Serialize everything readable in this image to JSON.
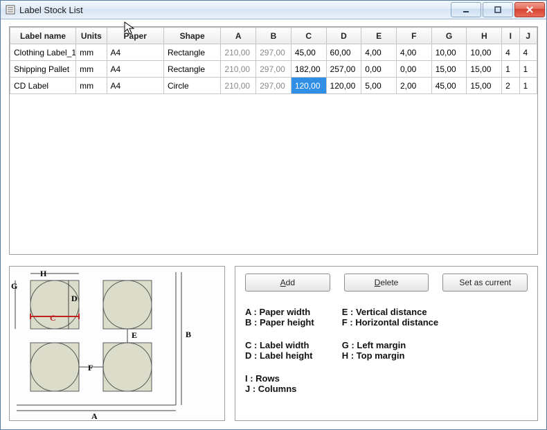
{
  "window": {
    "title": "Label Stock List"
  },
  "grid": {
    "headers": [
      "Label name",
      "Units",
      "Paper",
      "Shape",
      "A",
      "B",
      "C",
      "D",
      "E",
      "F",
      "G",
      "H",
      "I",
      "J"
    ],
    "rows": [
      {
        "name": "Clothing Label_1",
        "units": "mm",
        "paper": "A4",
        "shape": "Rectangle",
        "A": "210,00",
        "B": "297,00",
        "C": "45,00",
        "D": "60,00",
        "E": "4,00",
        "F": "4,00",
        "G": "10,00",
        "H": "10,00",
        "I": "4",
        "J": "4"
      },
      {
        "name": "Shipping Pallet",
        "units": "mm",
        "paper": "A4",
        "shape": "Rectangle",
        "A": "210,00",
        "B": "297,00",
        "C": "182,00",
        "D": "257,00",
        "E": "0,00",
        "F": "0,00",
        "G": "15,00",
        "H": "15,00",
        "I": "1",
        "J": "1"
      },
      {
        "name": "CD Label",
        "units": "mm",
        "paper": "A4",
        "shape": "Circle",
        "A": "210,00",
        "B": "297,00",
        "C": "120,00",
        "D": "120,00",
        "E": "5,00",
        "F": "2,00",
        "G": "45,00",
        "H": "15,00",
        "I": "2",
        "J": "1"
      }
    ],
    "selected": {
      "row": 2,
      "col": "C"
    }
  },
  "buttons": {
    "add": "Add",
    "delete": "Delete",
    "set_current": "Set as current"
  },
  "legend": {
    "A": "Paper width",
    "B": "Paper height",
    "C": "Label width",
    "D": "Label height",
    "E": "Vertical distance",
    "F": "Horizontal distance",
    "G": "Left margin",
    "H": "Top margin",
    "I": "Rows",
    "J": "Columns"
  },
  "diagram_letters": {
    "A": "A",
    "B": "B",
    "C": "C",
    "D": "D",
    "E": "E",
    "F": "F",
    "G": "G",
    "H": "H"
  }
}
